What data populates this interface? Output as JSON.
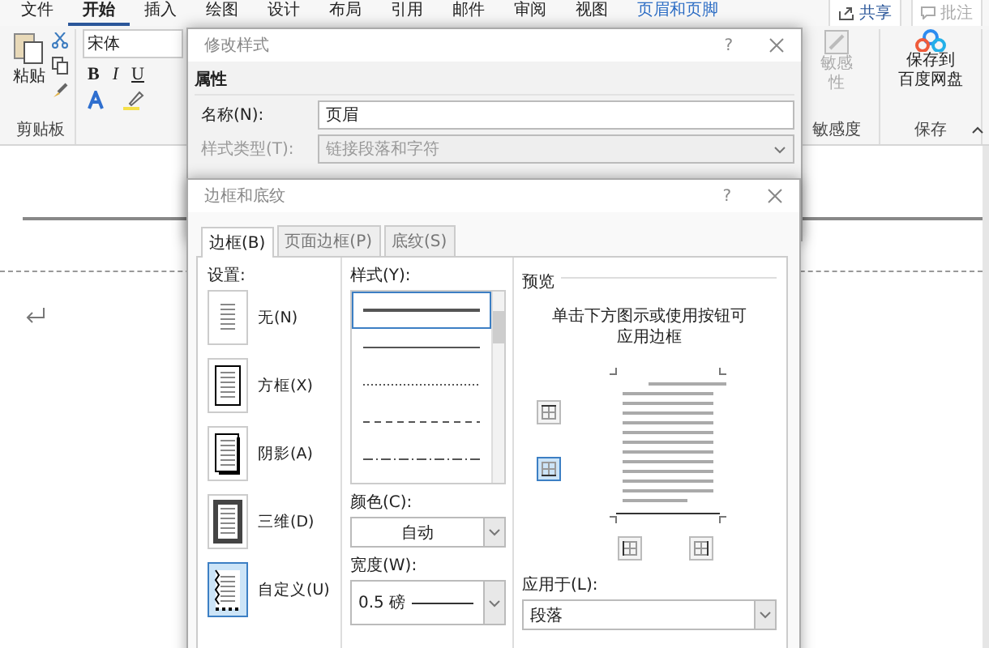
{
  "menu_tabs": [
    {
      "label": "文件",
      "selected": false,
      "kind": "normal"
    },
    {
      "label": "开始",
      "selected": true,
      "kind": "normal"
    },
    {
      "label": "插入",
      "selected": false,
      "kind": "normal"
    },
    {
      "label": "绘图",
      "selected": false,
      "kind": "normal"
    },
    {
      "label": "设计",
      "selected": false,
      "kind": "normal"
    },
    {
      "label": "布局",
      "selected": false,
      "kind": "normal"
    },
    {
      "label": "引用",
      "selected": false,
      "kind": "normal"
    },
    {
      "label": "邮件",
      "selected": false,
      "kind": "normal"
    },
    {
      "label": "审阅",
      "selected": false,
      "kind": "normal"
    },
    {
      "label": "视图",
      "selected": false,
      "kind": "normal"
    },
    {
      "label": "页眉和页脚",
      "selected": false,
      "kind": "contextual"
    }
  ],
  "share_button": "共享",
  "comment_button": {
    "label": "批注",
    "disabled": true
  },
  "ribbon": {
    "paste": "粘贴",
    "clipboard_group": "剪贴板",
    "font_name": "宋体",
    "format_buttons": [
      "B",
      "I",
      "U"
    ],
    "sensitivity": {
      "lines": [
        "敏感",
        "性"
      ],
      "disabled": true
    },
    "sensitivity_group": "敏感度",
    "save_cloud": [
      "保存到",
      "百度网盘"
    ],
    "save_group": "保存"
  },
  "modify_style_dialog": {
    "title": "修改样式",
    "help_button": "?",
    "section": "属性",
    "fields": [
      {
        "label": "名称(N):",
        "value": "页眉",
        "kind": "text",
        "disabled": false
      },
      {
        "label": "样式类型(T):",
        "value": "链接段落和字符",
        "kind": "dropdown",
        "disabled": true
      }
    ]
  },
  "borders_dialog": {
    "title": "边框和底纹",
    "help_button": "?",
    "tabs": [
      {
        "label": "边框(B)",
        "selected": true
      },
      {
        "label": "页面边框(P)",
        "selected": false
      },
      {
        "label": "底纹(S)",
        "selected": false
      }
    ],
    "settings_label": "设置:",
    "settings": [
      {
        "label": "无(N)",
        "kind": "none",
        "selected": false
      },
      {
        "label": "方框(X)",
        "kind": "box",
        "selected": false
      },
      {
        "label": "阴影(A)",
        "kind": "shadow",
        "selected": false
      },
      {
        "label": "三维(D)",
        "kind": "threed",
        "selected": false
      },
      {
        "label": "自定义(U)",
        "kind": "custom",
        "selected": true
      }
    ],
    "style_label": "样式(Y):",
    "line_styles": [
      {
        "kind": "thick",
        "selected": true
      },
      {
        "kind": "thin",
        "selected": false
      },
      {
        "kind": "dotted",
        "selected": false
      },
      {
        "kind": "dashed",
        "selected": false
      },
      {
        "kind": "dashdot",
        "selected": false
      }
    ],
    "color_label": "颜色(C):",
    "color_value": "自动",
    "width_label": "宽度(W):",
    "width_value": "0.5 磅",
    "preview_label": "预览",
    "preview_hint": "单击下方图示或使用按钮可应用边框",
    "border_buttons": [
      {
        "kind": "top",
        "selected": false
      },
      {
        "kind": "bottom",
        "selected": true
      },
      {
        "kind": "left",
        "selected": false
      },
      {
        "kind": "right",
        "selected": false
      }
    ],
    "apply_label": "应用于(L):",
    "apply_value": "段落"
  }
}
